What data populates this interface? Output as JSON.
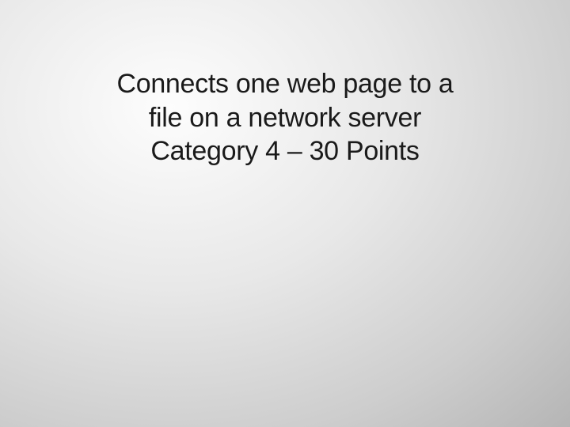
{
  "slide": {
    "line1": "Connects one web page to a",
    "line2": "file on a network server",
    "line3": "Category 4 – 30 Points"
  }
}
